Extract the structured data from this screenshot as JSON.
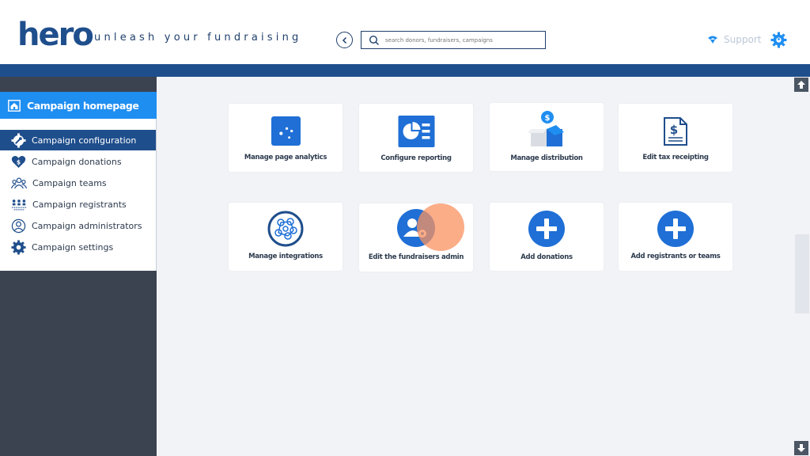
{
  "header": {
    "logo": "hero",
    "tagline": "unleash your fundraising",
    "search_placeholder": "search donors, fundraisers, campaigns",
    "support_label": "Support"
  },
  "sidebar": {
    "home_label": "Campaign homepage",
    "items": [
      {
        "label": "Campaign configuration",
        "icon": "gear-wrench-icon",
        "active": true
      },
      {
        "label": "Campaign donations",
        "icon": "heart-dollar-icon",
        "active": false
      },
      {
        "label": "Campaign teams",
        "icon": "people-group-icon",
        "active": false
      },
      {
        "label": "Campaign registrants",
        "icon": "registrants-icon",
        "active": false
      },
      {
        "label": "Campaign administrators",
        "icon": "admin-person-icon",
        "active": false
      },
      {
        "label": "Campaign settings",
        "icon": "gear-icon",
        "active": false
      }
    ]
  },
  "cards": [
    {
      "label": "Manage page analytics",
      "icon": "analytics-icon"
    },
    {
      "label": "Configure reporting",
      "icon": "pie-report-icon"
    },
    {
      "label": "Manage distribution",
      "icon": "box-dollar-icon"
    },
    {
      "label": "Edit tax receipting",
      "icon": "receipt-dollar-icon"
    },
    {
      "label": "Manage integrations",
      "icon": "network-icon"
    },
    {
      "label": "Edit the fundraisers admin",
      "icon": "user-gear-icon"
    },
    {
      "label": "Add donations",
      "icon": "plus-circle-icon"
    },
    {
      "label": "Add registrants or teams",
      "icon": "plus-circle-icon"
    }
  ],
  "colors": {
    "brand_dark": "#1f4e8c",
    "brand_bright": "#1f8ef1",
    "sidebar_dark": "#3c4350",
    "page_bg": "#f1f3f7"
  }
}
